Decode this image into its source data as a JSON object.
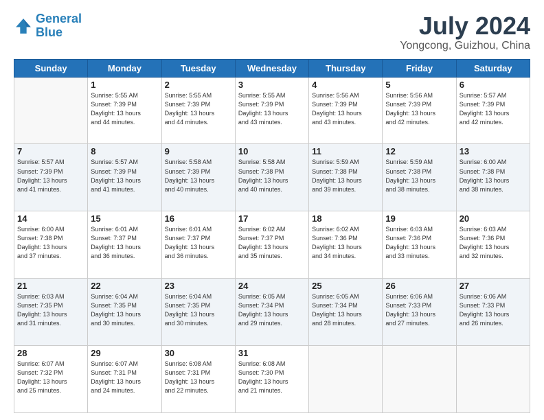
{
  "header": {
    "logo_line1": "General",
    "logo_line2": "Blue",
    "title": "July 2024",
    "subtitle": "Yongcong, Guizhou, China"
  },
  "weekdays": [
    "Sunday",
    "Monday",
    "Tuesday",
    "Wednesday",
    "Thursday",
    "Friday",
    "Saturday"
  ],
  "weeks": [
    [
      {
        "day": "",
        "info": ""
      },
      {
        "day": "1",
        "info": "Sunrise: 5:55 AM\nSunset: 7:39 PM\nDaylight: 13 hours\nand 44 minutes."
      },
      {
        "day": "2",
        "info": "Sunrise: 5:55 AM\nSunset: 7:39 PM\nDaylight: 13 hours\nand 44 minutes."
      },
      {
        "day": "3",
        "info": "Sunrise: 5:55 AM\nSunset: 7:39 PM\nDaylight: 13 hours\nand 43 minutes."
      },
      {
        "day": "4",
        "info": "Sunrise: 5:56 AM\nSunset: 7:39 PM\nDaylight: 13 hours\nand 43 minutes."
      },
      {
        "day": "5",
        "info": "Sunrise: 5:56 AM\nSunset: 7:39 PM\nDaylight: 13 hours\nand 42 minutes."
      },
      {
        "day": "6",
        "info": "Sunrise: 5:57 AM\nSunset: 7:39 PM\nDaylight: 13 hours\nand 42 minutes."
      }
    ],
    [
      {
        "day": "7",
        "info": "Sunrise: 5:57 AM\nSunset: 7:39 PM\nDaylight: 13 hours\nand 41 minutes."
      },
      {
        "day": "8",
        "info": "Sunrise: 5:57 AM\nSunset: 7:39 PM\nDaylight: 13 hours\nand 41 minutes."
      },
      {
        "day": "9",
        "info": "Sunrise: 5:58 AM\nSunset: 7:39 PM\nDaylight: 13 hours\nand 40 minutes."
      },
      {
        "day": "10",
        "info": "Sunrise: 5:58 AM\nSunset: 7:38 PM\nDaylight: 13 hours\nand 40 minutes."
      },
      {
        "day": "11",
        "info": "Sunrise: 5:59 AM\nSunset: 7:38 PM\nDaylight: 13 hours\nand 39 minutes."
      },
      {
        "day": "12",
        "info": "Sunrise: 5:59 AM\nSunset: 7:38 PM\nDaylight: 13 hours\nand 38 minutes."
      },
      {
        "day": "13",
        "info": "Sunrise: 6:00 AM\nSunset: 7:38 PM\nDaylight: 13 hours\nand 38 minutes."
      }
    ],
    [
      {
        "day": "14",
        "info": "Sunrise: 6:00 AM\nSunset: 7:38 PM\nDaylight: 13 hours\nand 37 minutes."
      },
      {
        "day": "15",
        "info": "Sunrise: 6:01 AM\nSunset: 7:37 PM\nDaylight: 13 hours\nand 36 minutes."
      },
      {
        "day": "16",
        "info": "Sunrise: 6:01 AM\nSunset: 7:37 PM\nDaylight: 13 hours\nand 36 minutes."
      },
      {
        "day": "17",
        "info": "Sunrise: 6:02 AM\nSunset: 7:37 PM\nDaylight: 13 hours\nand 35 minutes."
      },
      {
        "day": "18",
        "info": "Sunrise: 6:02 AM\nSunset: 7:36 PM\nDaylight: 13 hours\nand 34 minutes."
      },
      {
        "day": "19",
        "info": "Sunrise: 6:03 AM\nSunset: 7:36 PM\nDaylight: 13 hours\nand 33 minutes."
      },
      {
        "day": "20",
        "info": "Sunrise: 6:03 AM\nSunset: 7:36 PM\nDaylight: 13 hours\nand 32 minutes."
      }
    ],
    [
      {
        "day": "21",
        "info": "Sunrise: 6:03 AM\nSunset: 7:35 PM\nDaylight: 13 hours\nand 31 minutes."
      },
      {
        "day": "22",
        "info": "Sunrise: 6:04 AM\nSunset: 7:35 PM\nDaylight: 13 hours\nand 30 minutes."
      },
      {
        "day": "23",
        "info": "Sunrise: 6:04 AM\nSunset: 7:35 PM\nDaylight: 13 hours\nand 30 minutes."
      },
      {
        "day": "24",
        "info": "Sunrise: 6:05 AM\nSunset: 7:34 PM\nDaylight: 13 hours\nand 29 minutes."
      },
      {
        "day": "25",
        "info": "Sunrise: 6:05 AM\nSunset: 7:34 PM\nDaylight: 13 hours\nand 28 minutes."
      },
      {
        "day": "26",
        "info": "Sunrise: 6:06 AM\nSunset: 7:33 PM\nDaylight: 13 hours\nand 27 minutes."
      },
      {
        "day": "27",
        "info": "Sunrise: 6:06 AM\nSunset: 7:33 PM\nDaylight: 13 hours\nand 26 minutes."
      }
    ],
    [
      {
        "day": "28",
        "info": "Sunrise: 6:07 AM\nSunset: 7:32 PM\nDaylight: 13 hours\nand 25 minutes."
      },
      {
        "day": "29",
        "info": "Sunrise: 6:07 AM\nSunset: 7:31 PM\nDaylight: 13 hours\nand 24 minutes."
      },
      {
        "day": "30",
        "info": "Sunrise: 6:08 AM\nSunset: 7:31 PM\nDaylight: 13 hours\nand 22 minutes."
      },
      {
        "day": "31",
        "info": "Sunrise: 6:08 AM\nSunset: 7:30 PM\nDaylight: 13 hours\nand 21 minutes."
      },
      {
        "day": "",
        "info": ""
      },
      {
        "day": "",
        "info": ""
      },
      {
        "day": "",
        "info": ""
      }
    ]
  ]
}
